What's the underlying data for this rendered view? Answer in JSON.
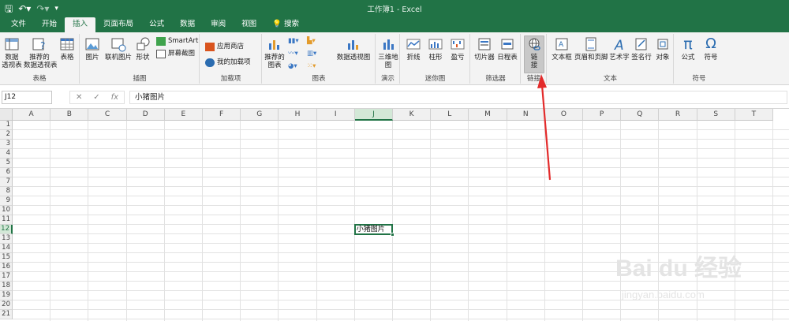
{
  "window": {
    "title": "工作簿1  -  Excel"
  },
  "quick_access": {
    "save_icon": "save-icon",
    "undo_icon": "undo-icon",
    "redo_icon": "redo-icon",
    "customize_icon": "customize-icon"
  },
  "tabs": [
    "文件",
    "开始",
    "插入",
    "页面布局",
    "公式",
    "数据",
    "审阅",
    "视图"
  ],
  "active_tab": "插入",
  "tell_me": "搜索",
  "ribbon": {
    "tables": {
      "label": "表格",
      "pivot": "数据\n透视表",
      "rec_pivot": "推荐的\n数据透视表",
      "table": "表格"
    },
    "illustrations": {
      "label": "插图",
      "picture": "图片",
      "online_picture": "联机图片",
      "shapes": "形状",
      "smartart": "SmartArt",
      "screenshot": "屏幕截图"
    },
    "addins": {
      "label": "加载项",
      "store": "应用商店",
      "my_addins": "我的加载项"
    },
    "charts": {
      "label": "图表",
      "recommended": "推荐的\n图表",
      "pivot_chart": "数据透视图"
    },
    "tours": {
      "label": "演示",
      "map3d": "三维地\n图"
    },
    "sparklines": {
      "label": "迷你图",
      "line": "折线",
      "column": "柱形",
      "winloss": "盈亏"
    },
    "filters": {
      "label": "筛选器",
      "slicer": "切片器",
      "timeline": "日程表"
    },
    "links": {
      "label": "链接",
      "link": "链\n接"
    },
    "text": {
      "label": "文本",
      "textbox": "文本框",
      "header_footer": "页眉和页脚",
      "wordart": "艺术字",
      "signature": "签名行",
      "object": "对象"
    },
    "symbols": {
      "label": "符号",
      "equation": "公式",
      "symbol": "符号"
    }
  },
  "formula_bar": {
    "name_box": "J12",
    "fx": "fx",
    "cancel": "✕",
    "enter": "✓",
    "content": "小猪图片"
  },
  "columns": [
    "A",
    "B",
    "C",
    "D",
    "E",
    "F",
    "G",
    "H",
    "I",
    "J",
    "K",
    "L",
    "M",
    "N",
    "O",
    "P",
    "Q",
    "R",
    "S",
    "T"
  ],
  "rows": [
    "1",
    "2",
    "3",
    "4",
    "5",
    "6",
    "7",
    "8",
    "9",
    "10",
    "11",
    "12",
    "13",
    "14",
    "15",
    "16",
    "17",
    "18",
    "19",
    "20",
    "21"
  ],
  "selected_column": "J",
  "selected_row": "12",
  "cell_value": "小猪图片",
  "watermark": {
    "brand": "Bai du 经验",
    "url": "jingyan.baidu.com"
  },
  "colors": {
    "excel_green": "#217346",
    "arrow_red": "#e32b2b"
  }
}
